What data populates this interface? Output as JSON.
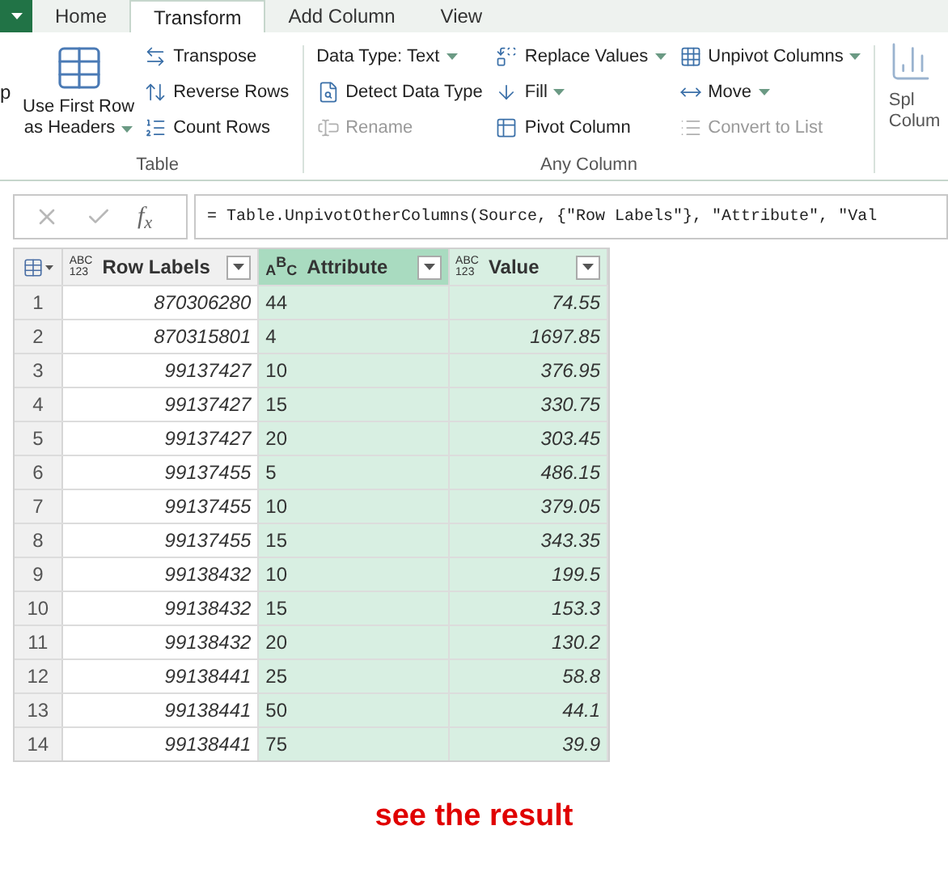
{
  "tabs": [
    {
      "label": "Home",
      "selected": false
    },
    {
      "label": "Transform",
      "selected": true
    },
    {
      "label": "Add Column",
      "selected": false
    },
    {
      "label": "View",
      "selected": false
    }
  ],
  "ribbon": {
    "left_cut_label": "p",
    "groups": [
      {
        "label": "Table",
        "big_button": {
          "lines": [
            "Use First Row",
            "as Headers"
          ],
          "dropdown": true
        },
        "columns": [
          [
            {
              "label": "Transpose",
              "dropdown": false,
              "disabled": false
            },
            {
              "label": "Reverse Rows",
              "dropdown": false,
              "disabled": false
            },
            {
              "label": "Count Rows",
              "dropdown": false,
              "disabled": false
            }
          ]
        ]
      },
      {
        "label": "Any Column",
        "columns": [
          [
            {
              "label": "Data Type: Text",
              "dropdown": true,
              "disabled": false
            },
            {
              "label": "Detect Data Type",
              "dropdown": false,
              "disabled": false
            },
            {
              "label": "Rename",
              "dropdown": false,
              "disabled": true
            }
          ],
          [
            {
              "label": "Replace Values",
              "dropdown": true,
              "disabled": false
            },
            {
              "label": "Fill",
              "dropdown": true,
              "disabled": false
            },
            {
              "label": "Pivot Column",
              "dropdown": false,
              "disabled": false
            }
          ],
          [
            {
              "label": "Unpivot Columns",
              "dropdown": true,
              "disabled": false
            },
            {
              "label": "Move",
              "dropdown": true,
              "disabled": false
            },
            {
              "label": "Convert to List",
              "dropdown": false,
              "disabled": true
            }
          ]
        ]
      }
    ],
    "right_cut_lines": [
      "Spl",
      "Colum"
    ]
  },
  "formula_bar": {
    "fx": "f$_{x}$",
    "formula": "= Table.UnpivotOtherColumns(Source, {\"Row Labels\"}, \"Attribute\", \"Val"
  },
  "table": {
    "columns": [
      {
        "name": "Row Labels",
        "kind": "any",
        "type_glyph": [
          "ABC",
          "123"
        ],
        "selected": false,
        "shaded": false
      },
      {
        "name": "Attribute",
        "kind": "text",
        "type_glyph": [
          "A",
          "B",
          "C"
        ],
        "selected": true,
        "shaded": true
      },
      {
        "name": "Value",
        "kind": "any",
        "type_glyph": [
          "ABC",
          "123"
        ],
        "selected": false,
        "shaded": true
      }
    ],
    "rows": [
      {
        "number": "1",
        "cells": [
          "870306280",
          "44",
          "74.55"
        ]
      },
      {
        "number": "2",
        "cells": [
          "870315801",
          "4",
          "1697.85"
        ]
      },
      {
        "number": "3",
        "cells": [
          "99137427",
          "10",
          "376.95"
        ]
      },
      {
        "number": "4",
        "cells": [
          "99137427",
          "15",
          "330.75"
        ]
      },
      {
        "number": "5",
        "cells": [
          "99137427",
          "20",
          "303.45"
        ]
      },
      {
        "number": "6",
        "cells": [
          "99137455",
          "5",
          "486.15"
        ]
      },
      {
        "number": "7",
        "cells": [
          "99137455",
          "10",
          "379.05"
        ]
      },
      {
        "number": "8",
        "cells": [
          "99137455",
          "15",
          "343.35"
        ]
      },
      {
        "number": "9",
        "cells": [
          "99138432",
          "10",
          "199.5"
        ]
      },
      {
        "number": "10",
        "cells": [
          "99138432",
          "15",
          "153.3"
        ]
      },
      {
        "number": "11",
        "cells": [
          "99138432",
          "20",
          "130.2"
        ]
      },
      {
        "number": "12",
        "cells": [
          "99138441",
          "25",
          "58.8"
        ]
      },
      {
        "number": "13",
        "cells": [
          "99138441",
          "50",
          "44.1"
        ]
      },
      {
        "number": "14",
        "cells": [
          "99138441",
          "75",
          "39.9"
        ]
      }
    ]
  },
  "caption": "see the result"
}
